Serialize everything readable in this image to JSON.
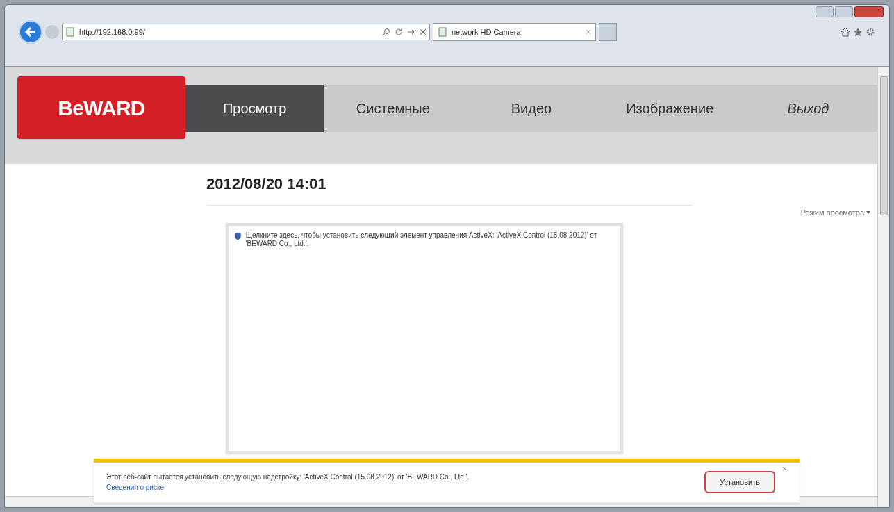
{
  "browser": {
    "address": "http://192.168.0.99/",
    "tab_title": "network HD Camera"
  },
  "logo": {
    "text": "BeWARD"
  },
  "nav": [
    {
      "label": "Просмотр",
      "selected": true
    },
    {
      "label": "Системные",
      "selected": false
    },
    {
      "label": "Видео",
      "selected": false
    },
    {
      "label": "Изображение",
      "selected": false
    },
    {
      "label": "Выход",
      "selected": false
    }
  ],
  "datetime": "2012/08/20 14:01",
  "view_mode": "Режим просмотра",
  "activex_box": {
    "message": "Щелкните здесь, чтобы установить следующий элемент управления ActiveX: 'ActiveX Control (15.08.2012)' от 'BEWARD Co., Ltd.'."
  },
  "notification": {
    "message": "Этот веб-сайт пытается установить следующую надстройку: 'ActiveX Control (15.08.2012)' от 'BEWARD Co., Ltd.'.",
    "link": "Сведения о риске",
    "button": "Установить",
    "close": "×"
  }
}
